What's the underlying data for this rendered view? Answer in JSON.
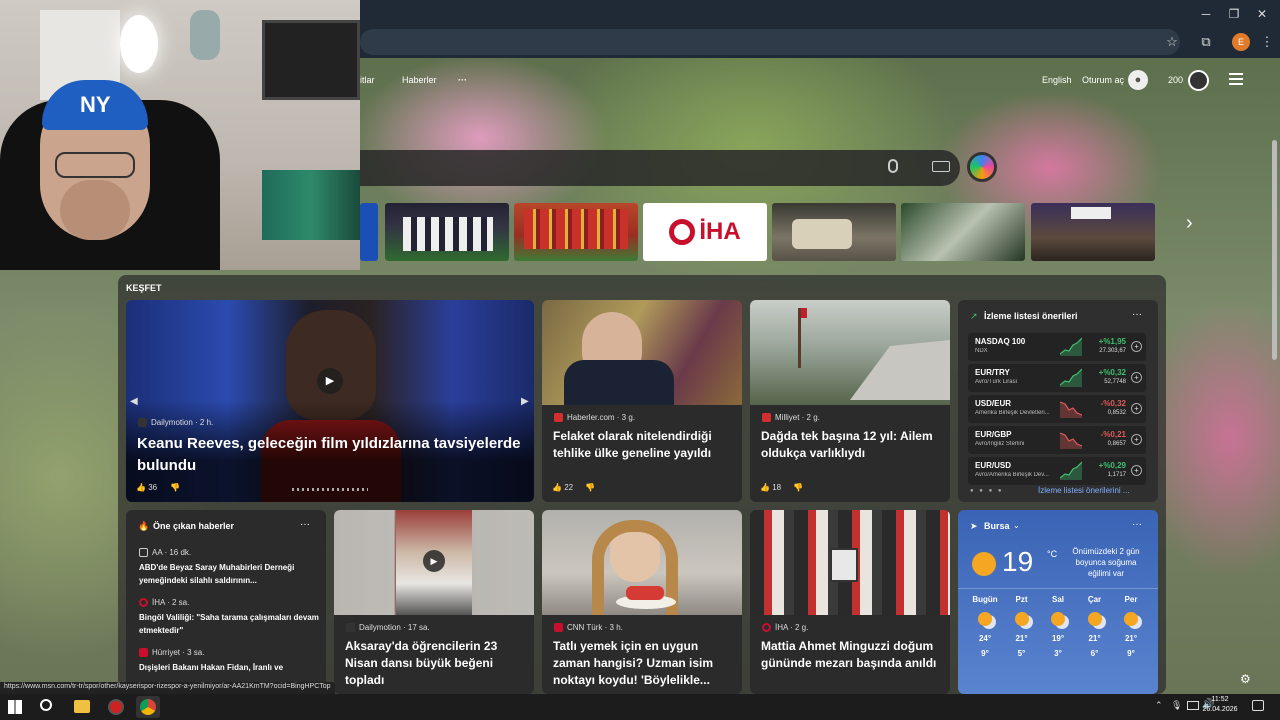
{
  "browser": {
    "status_url": "https://www.msn.com/tr-tr/spor/other/kayserispor-rizespor-a-yenilmiyor/ar-AA21KmTM?ocid=BingHPCTop",
    "profile_initial": "E"
  },
  "header": {
    "nav": [
      "itlar",
      "Haberler",
      "···"
    ],
    "language": "English",
    "signin": "Oturum aç",
    "points": "200"
  },
  "section_title": "KEŞFET",
  "hero": {
    "source": "Dailymotion · 2 h.",
    "title": "Keanu Reeves, geleceğin film yıldızlarına tavsiyelerde bulundu",
    "likes": "36"
  },
  "cards": [
    {
      "source": "Haberler.com · 3 g.",
      "title": "Felaket olarak nitelendirdiği tehlike ülke geneline yayıldı",
      "likes": "22"
    },
    {
      "source": "Milliyet · 2 g.",
      "title": "Dağda tek başına 12 yıl: Ailem oldukça varlıklıydı",
      "likes": "18"
    },
    {
      "source": "Dailymotion · 17 sa.",
      "title": "Aksaray'da öğrencilerin 23 Nisan dansı büyük beğeni topladı"
    },
    {
      "source": "CNN Türk · 3 h.",
      "title": "Tatlı yemek için en uygun zaman hangisi? Uzman isim noktayı koydu! 'Böylelikle..."
    },
    {
      "source": "İHA · 2 g.",
      "title": "Mattia Ahmet Minguzzi doğum gününde mezarı başında anıldı"
    }
  ],
  "thumb_logo": "İHA",
  "watchlist": {
    "title": "İzleme listesi önerileri",
    "more": "İzleme listesi önerilerini ...",
    "items": [
      {
        "name": "NASDAQ 100",
        "sub": "NDX",
        "change": "+%1,95",
        "value": "27.303,67",
        "up": true
      },
      {
        "name": "EUR/TRY",
        "sub": "Avro/Türk Lirası",
        "change": "+%0,32",
        "value": "52,7748",
        "up": true
      },
      {
        "name": "USD/EUR",
        "sub": "Amerika Birleşik Devletleri...",
        "change": "-%0,32",
        "value": "0,8532",
        "up": false
      },
      {
        "name": "EUR/GBP",
        "sub": "Avro/İngiliz Sterlini",
        "change": "-%0,21",
        "value": "0,8657",
        "up": false
      },
      {
        "name": "EUR/USD",
        "sub": "Avro/Amerika Birleşik Dev...",
        "change": "+%0,29",
        "value": "1,1717",
        "up": true
      }
    ]
  },
  "top_news": {
    "title": "Öne çıkan haberler",
    "items": [
      {
        "source": "AA · 16 dk.",
        "title": "ABD'de Beyaz Saray Muhabirleri Derneği yemeğindeki silahlı saldırının..."
      },
      {
        "source": "İHA · 2 sa.",
        "title": "Bingöl Valiliği: \"Saha tarama çalışmaları devam etmektedir\""
      },
      {
        "source": "Hürriyet · 3 sa.",
        "title": "Dışişleri Bakanı Hakan Fidan, İranlı ve"
      }
    ]
  },
  "weather": {
    "city": "Bursa",
    "temp": "19",
    "unit": "°C",
    "note": "Önümüzdeki 2 gün boyunca soğuma eğilimi var",
    "days": [
      {
        "name": "Bugün",
        "hi": "24°",
        "lo": "9°"
      },
      {
        "name": "Pzt",
        "hi": "21°",
        "lo": "5°"
      },
      {
        "name": "Sal",
        "hi": "19°",
        "lo": "3°"
      },
      {
        "name": "Çar",
        "hi": "21°",
        "lo": "6°"
      },
      {
        "name": "Per",
        "hi": "21°",
        "lo": "9°"
      }
    ]
  },
  "taskbar": {
    "time": "11:52",
    "date": "26.04.2026"
  },
  "colors": {
    "accent_green": "#3fbf6f",
    "accent_red": "#e05a5a",
    "panel": "#2b2b2b",
    "weather_bg": "#3a63b5"
  }
}
